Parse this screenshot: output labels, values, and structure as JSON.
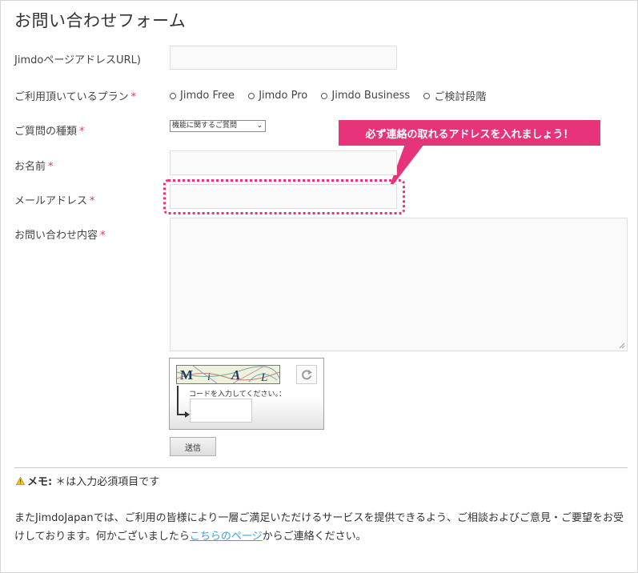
{
  "form": {
    "title": "お問い合わせフォーム",
    "required_mark": "*",
    "fields": {
      "url": {
        "label": "JimdoページアドレスURL)"
      },
      "plan": {
        "label": "ご利用頂いているプラン",
        "options": [
          "Jimdo Free",
          "Jimdo Pro",
          "Jimdo Business",
          "ご検討段階"
        ]
      },
      "question_type": {
        "label": "ご質問の種類",
        "selected": "機能に関するご質問"
      },
      "name": {
        "label": "お名前"
      },
      "email": {
        "label": "メールアドレス"
      },
      "message": {
        "label": "お問い合わせ内容"
      }
    },
    "callout": "必ず連絡の取れるアドレスを入れましょう！",
    "captcha": {
      "letters": [
        "M",
        "i",
        "A",
        "L"
      ],
      "prompt": "コードを入力してください。："
    },
    "submit_label": "送信"
  },
  "memo": {
    "prefix": "メモ:",
    "text": "＊は入力必須項目です"
  },
  "footer": {
    "text_before": "またJimdoJapanでは、ご利用の皆様により一層ご満足いただけるサービスを提供できるよう、ご相談およびご意見・ご要望をお受けしております。何かございましたら",
    "link_text": "こちらのページ",
    "text_after": "からご連絡ください。"
  },
  "colors": {
    "accent": "#e6337a",
    "required": "#e8336a",
    "link": "#3aa3d8"
  }
}
